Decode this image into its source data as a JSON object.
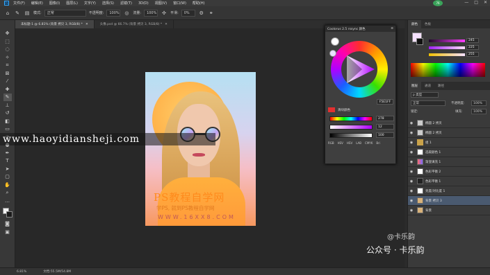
{
  "app": {
    "menu": [
      "文件(F)",
      "编辑(E)",
      "图像(I)",
      "图层(L)",
      "文字(Y)",
      "选择(S)",
      "滤镜(T)",
      "3D(D)",
      "视图(V)",
      "窗口(W)",
      "帮助(H)"
    ]
  },
  "options": {
    "mode_label": "模式:",
    "mode_value": "正常",
    "opacity_label": "不透明度:",
    "opacity_value": "100%",
    "flow_label": "流量:",
    "flow_value": "100%",
    "smooth_label": "平滑:",
    "smooth_value": "0%"
  },
  "tabs": [
    {
      "label": "未标题-1 @ 6.81% (背景 拷贝 3, RGB/8) *"
    },
    {
      "label": "头像.psd @ 66.7% (背景 拷贝 3, RGB/8) *"
    }
  ],
  "document": {
    "wm_title": "PS教程自学网",
    "wm_sub": "学PS, 就到PS教程自学网",
    "wm_url": "WWW.16XX8.COM"
  },
  "overlay": {
    "site_url": "www.haoyidiansheji.com"
  },
  "coolorus": {
    "title": "Coolorus 2.5 rssync 颜色",
    "hex": "F5E1FF",
    "r_label": "滑块颜色",
    "v1": "278",
    "v2": "12",
    "v3": "100",
    "mode_tabs": [
      "RGB",
      "HSV",
      "HSV",
      "LAB",
      "CMYK",
      "Bri"
    ]
  },
  "right": {
    "color_tabs": [
      "颜色",
      "色板"
    ],
    "rgb_values": [
      "245",
      "225",
      "255"
    ],
    "layer_tabs": [
      "图层",
      "通道",
      "路径"
    ],
    "kind_label": "p 类型",
    "blend": "正常",
    "opacity_label": "不透明度:",
    "opacity": "100%",
    "lock_label": "锁定:",
    "fill_label": "填充:",
    "fill": "100%",
    "layers": [
      {
        "name": "椭圆 2 拷贝"
      },
      {
        "name": "椭圆 2 拷贝"
      },
      {
        "name": "组 1"
      },
      {
        "name": "选取颜色 1"
      },
      {
        "name": "渐变填充 1"
      },
      {
        "name": "色彩平衡 2"
      },
      {
        "name": "色彩平衡 1"
      },
      {
        "name": "亮度/对比度 1"
      },
      {
        "name": "背景 拷贝 3"
      },
      {
        "name": "背景"
      }
    ]
  },
  "status": {
    "zoom": "6.81%",
    "doc": "文档:55.5M/54.8M"
  },
  "watermark": {
    "line1": "@卡乐韵",
    "line2": "公众号 · 卡乐韵"
  },
  "colors": {
    "accent": "#31a8ff",
    "layer_highlight": "#4a5a70"
  }
}
